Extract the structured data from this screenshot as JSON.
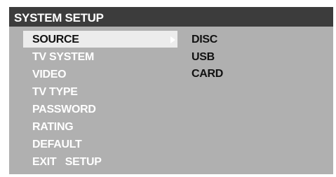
{
  "title": "SYSTEM SETUP",
  "menu": {
    "items": [
      {
        "label": "SOURCE",
        "selected": true
      },
      {
        "label": "TV SYSTEM",
        "selected": false
      },
      {
        "label": "VIDEO",
        "selected": false
      },
      {
        "label": "TV TYPE",
        "selected": false
      },
      {
        "label": "PASSWORD",
        "selected": false
      },
      {
        "label": "RATING",
        "selected": false
      },
      {
        "label": "DEFAULT",
        "selected": false
      },
      {
        "label": "EXIT   SETUP",
        "selected": false
      }
    ]
  },
  "submenu": {
    "options": [
      {
        "label": "DISC"
      },
      {
        "label": "USB"
      },
      {
        "label": "CARD"
      }
    ]
  },
  "icons": {
    "selection_arrow": "arrow-right-icon"
  },
  "colors": {
    "panel": "#b0b0b0",
    "title_bar": "#3c3c3c",
    "highlight": "#ececec",
    "text_light": "#ffffff",
    "text_dark": "#111111"
  }
}
